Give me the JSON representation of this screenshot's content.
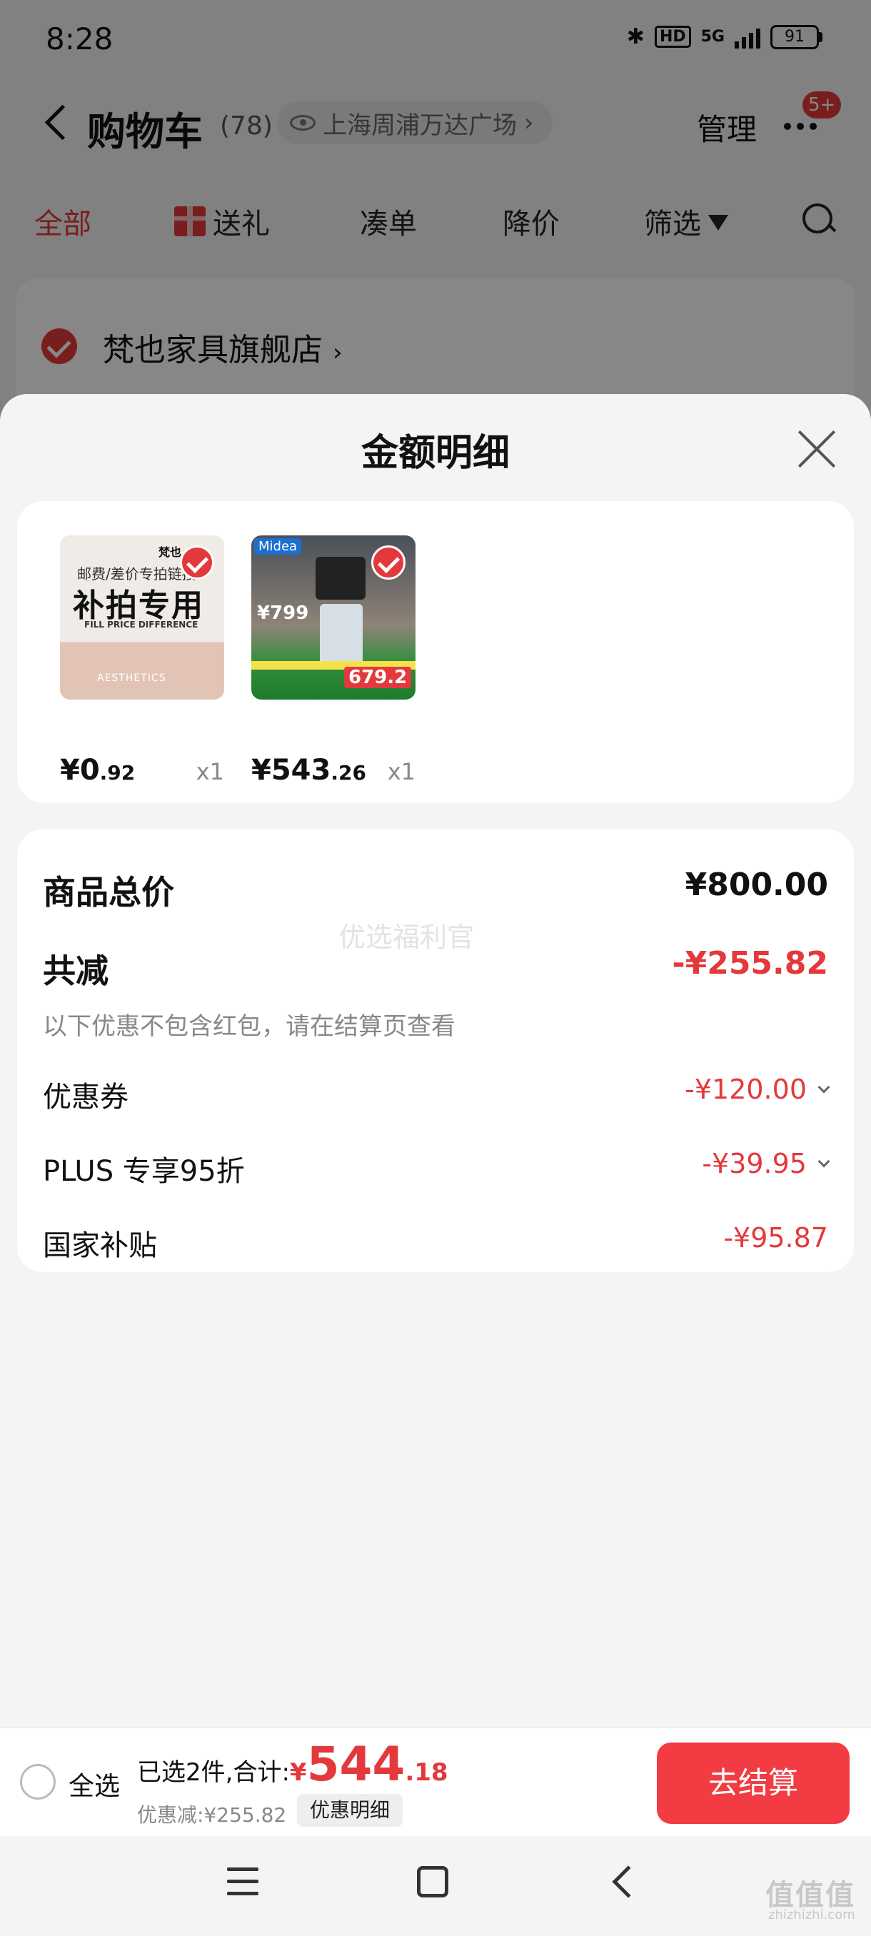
{
  "status_bar": {
    "time": "8:28",
    "network": "5G",
    "hd": "HD",
    "battery": "91"
  },
  "cart_header": {
    "title": "购物车",
    "count": "(78)",
    "location": "上海周浦万达广场",
    "location_chevron": "›",
    "manage_label": "管理",
    "badge": "5+"
  },
  "tabs": [
    {
      "label": "全部",
      "active": true
    },
    {
      "label": "送礼",
      "icon": "gift-icon"
    },
    {
      "label": "凑单"
    },
    {
      "label": "降价"
    },
    {
      "label": "筛选",
      "icon": "filter-icon"
    }
  ],
  "store": {
    "name": "梵也家具旗舰店",
    "chevron": "›"
  },
  "sheet": {
    "title": "金额明细",
    "products": [
      {
        "price_int": "¥0",
        "price_dec": ".92",
        "qty": "x1",
        "image_text": {
          "top": "邮费/差价专拍链接",
          "main": "补拍专用",
          "sub": "FILL PRICE DIFFERENCE",
          "bottom": "AESTHETICS",
          "logo": "梵也"
        }
      },
      {
        "price_int": "¥543",
        "price_dec": ".26",
        "qty": "x1",
        "image_text": {
          "brand": "Midea",
          "price_a": "¥799",
          "price_b": "679.2"
        }
      }
    ],
    "summary": {
      "total_label": "商品总价",
      "total_value": "¥800.00",
      "reduce_label": "共减",
      "reduce_value": "-¥255.82",
      "note": "以下优惠不包含红包，请在结算页查看",
      "watermark": "优选福利官",
      "items": [
        {
          "label": "优惠券",
          "value": "-¥120.00",
          "expandable": true
        },
        {
          "label": "PLUS 专享95折",
          "value": "-¥39.95",
          "expandable": true
        },
        {
          "label": "国家补贴",
          "value": "-¥95.87",
          "expandable": false
        }
      ]
    }
  },
  "bottom_bar": {
    "select_all": "全选",
    "selected_text": "已选2件,合计:",
    "total_yen": "¥",
    "total_int": "544",
    "total_dec": ".18",
    "discount_text": "优惠减:¥255.82",
    "detail_label": "优惠明细",
    "checkout_label": "去结算"
  },
  "watermark_corner": {
    "logo": "值值值",
    "url": "zhizhizhi.com"
  },
  "colors": {
    "accent": "#e4393c",
    "checkout": "#f23b42",
    "sheet_bg": "#f4f4f4"
  }
}
